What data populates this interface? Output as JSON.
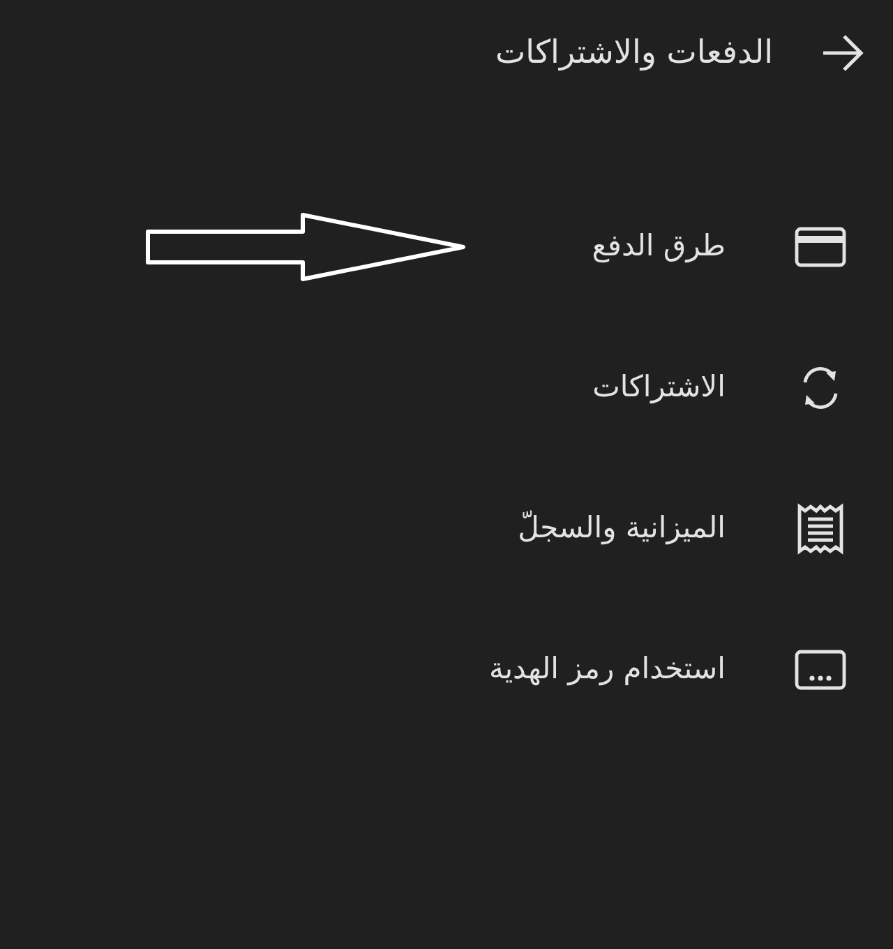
{
  "header": {
    "title": "الدفعات والاشتراكات"
  },
  "items": [
    {
      "kind": "card",
      "label": "طرق الدفع",
      "pointed": true
    },
    {
      "kind": "sync",
      "label": "الاشتراكات",
      "pointed": false
    },
    {
      "kind": "receipt",
      "label": "الميزانية والسجلّ",
      "pointed": false
    },
    {
      "kind": "giftcard",
      "label": "استخدام رمز الهدية",
      "pointed": false
    }
  ]
}
